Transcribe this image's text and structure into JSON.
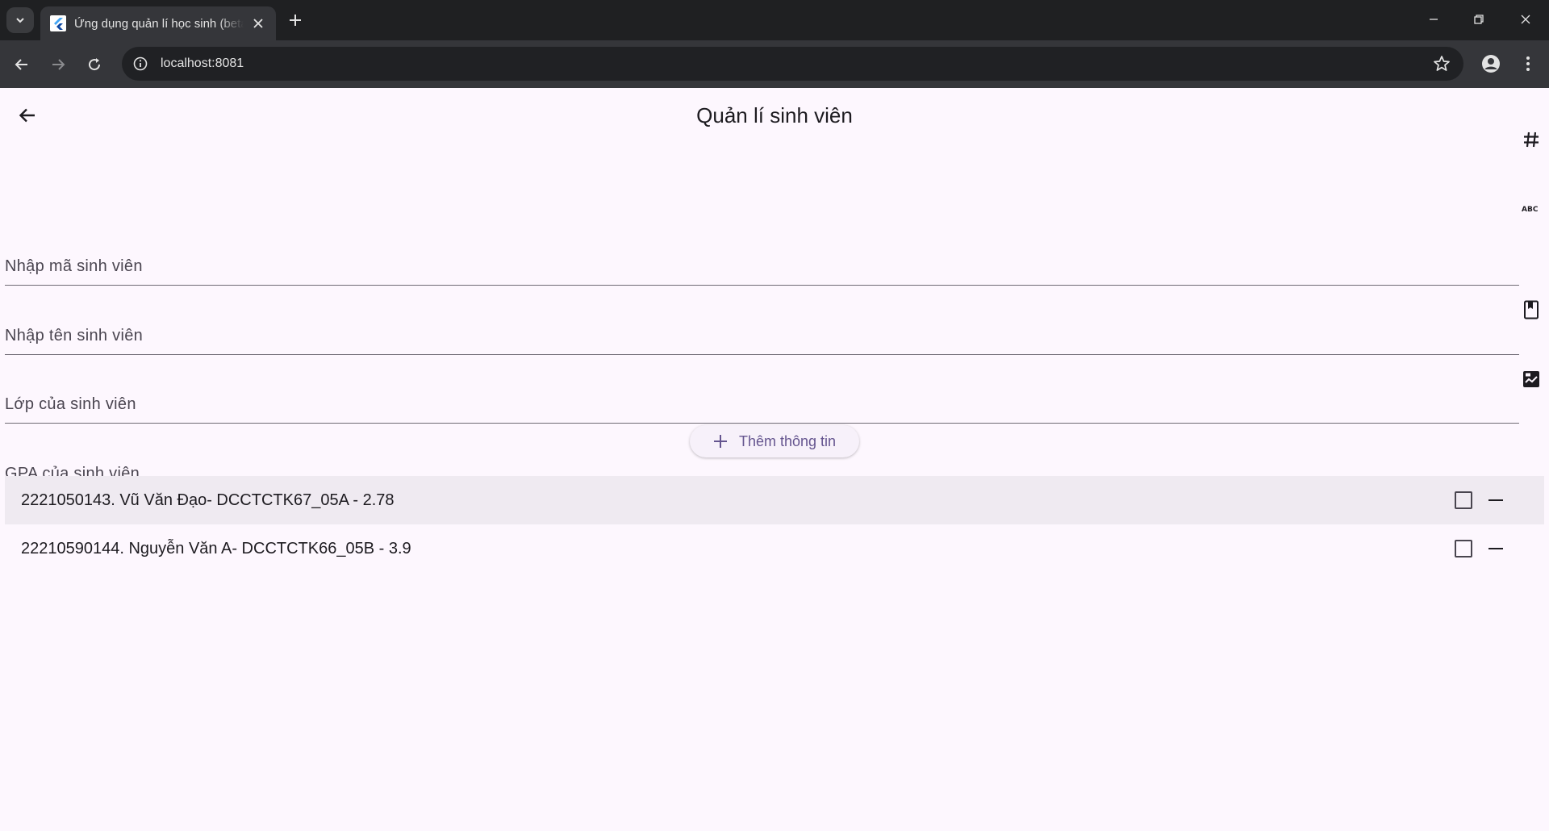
{
  "browser": {
    "tab_title": "Ứng dụng quản lí học sinh (beta)",
    "url": "localhost:8081"
  },
  "app": {
    "title": "Quản lí sinh viên",
    "fields": {
      "student_id": {
        "placeholder": "Nhập mã sinh viên",
        "icon": "hash-icon"
      },
      "student_name": {
        "placeholder": "Nhập tên sinh viên",
        "icon": "abc-icon"
      },
      "student_class": {
        "placeholder": "Lớp của sinh viên",
        "icon": "class-book-icon"
      },
      "student_gpa": {
        "placeholder": "GPA của sinh viên",
        "icon": "score-chart-icon"
      }
    },
    "add_button_label": "Thêm thông tin",
    "students": [
      {
        "text": "2221050143. Vũ Văn Đạo- DCCTCTK67_05A - 2.78",
        "checked": false
      },
      {
        "text": "22210590144. Nguyễn Văn A- DCCTCTK66_05B - 3.9",
        "checked": false
      }
    ]
  },
  "colors": {
    "accent": "#65558f",
    "background": "#fdf7fe",
    "chrome_dark": "#1f2022",
    "toolbar": "#35363a"
  }
}
